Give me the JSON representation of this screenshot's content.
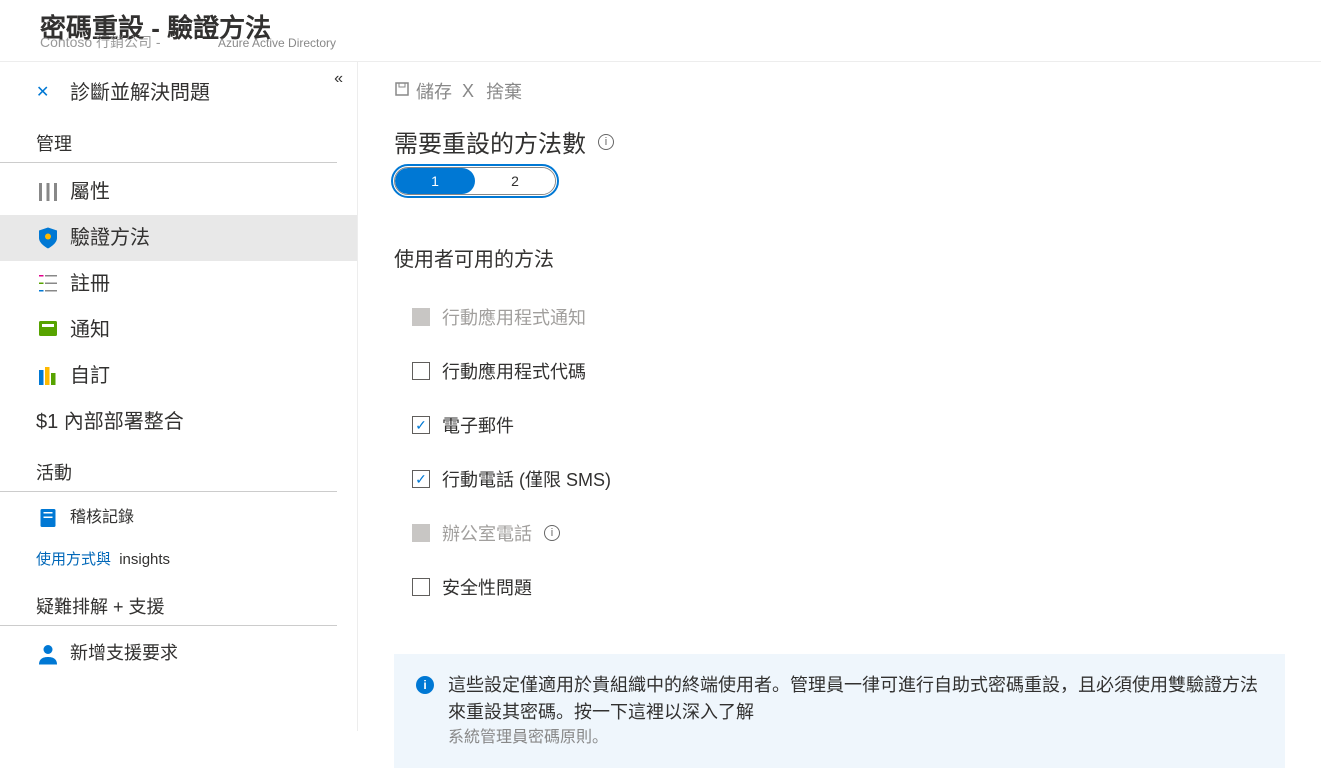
{
  "header": {
    "title": "密碼重設 - 驗證方法",
    "org": "Contoso 行銷公司 -",
    "service": "Azure Active Directory"
  },
  "sidebar": {
    "diagnose": "診斷並解決問題",
    "section_manage": "管理",
    "properties": "屬性",
    "auth_methods": "驗證方法",
    "registration": "註冊",
    "notifications": "通知",
    "customization": "自訂",
    "onprem": "$1 內部部署整合",
    "section_activity": "活動",
    "audit_logs": "稽核記錄",
    "usage_a": "使用方式與",
    "usage_b": "insights",
    "section_trouble": "疑難排解 +  支援",
    "new_support": "新增支援要求"
  },
  "toolbar": {
    "save": "儲存",
    "discard": "捨棄"
  },
  "settings": {
    "methods_count_title": "需要重設的方法數",
    "opt1": "1",
    "opt2": "2",
    "available_title": "使用者可用的方法",
    "m_app_notification": "行動應用程式通知",
    "m_app_code": "行動應用程式代碼",
    "m_email": "電子郵件",
    "m_phone": "行動電話 (僅限 SMS)",
    "m_office": "辦公室電話",
    "m_security_q": "安全性問題"
  },
  "banner": {
    "main": "這些設定僅適用於貴組織中的終端使用者。管理員一律可進行自助式密碼重設，且必須使用雙驗證方法來重設其密碼。按一下這裡以深入了解",
    "sub": "系統管理員密碼原則。"
  }
}
